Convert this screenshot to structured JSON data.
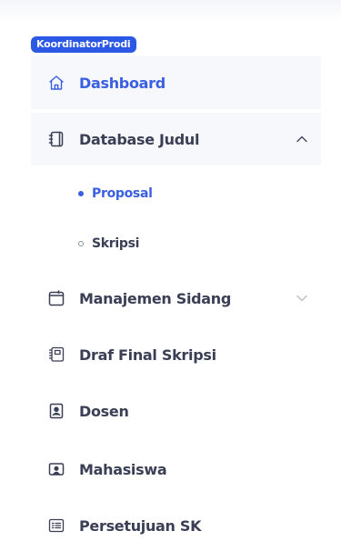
{
  "role_badge": "KoordinatorProdi",
  "menu": {
    "dashboard": {
      "label": "Dashboard",
      "icon": "home-icon"
    },
    "database_judul": {
      "label": "Database Judul",
      "icon": "notebook-icon",
      "expanded": true,
      "submenu": [
        {
          "label": "Proposal",
          "active": true
        },
        {
          "label": "Skripsi",
          "active": false
        }
      ]
    },
    "manajemen_sidang": {
      "label": "Manajemen Sidang",
      "icon": "calendar-icon",
      "expanded": false
    },
    "draf_final_skripsi": {
      "label": "Draf Final Skripsi",
      "icon": "book-icon"
    },
    "dosen": {
      "label": "Dosen",
      "icon": "user-document-icon"
    },
    "mahasiswa": {
      "label": "Mahasiswa",
      "icon": "user-screen-icon"
    },
    "persetujuan_sk": {
      "label": "Persetujuan SK",
      "icon": "list-card-icon"
    }
  },
  "colors": {
    "accent": "#3a5fe0",
    "badge": "#2b59e6",
    "text": "#3a3f55",
    "active_bg": "#f6f8fb"
  }
}
